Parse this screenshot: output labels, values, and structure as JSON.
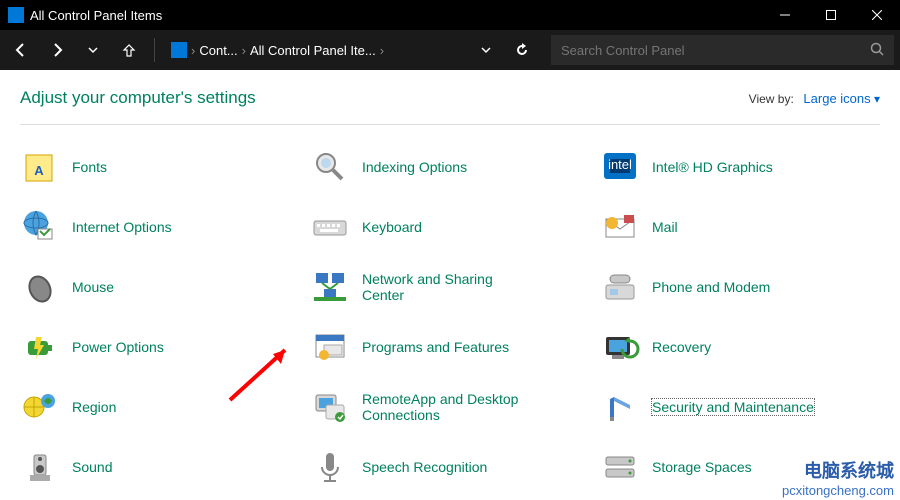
{
  "title": "All Control Panel Items",
  "breadcrumb": {
    "crumb1": "Cont...",
    "crumb2": "All Control Panel Ite..."
  },
  "search": {
    "placeholder": "Search Control Panel"
  },
  "header": {
    "heading": "Adjust your computer's settings",
    "viewby": "View by:",
    "viewby_value": "Large icons"
  },
  "items": {
    "fonts": "Fonts",
    "indexing": "Indexing Options",
    "intel": "Intel® HD Graphics",
    "internet": "Internet Options",
    "keyboard": "Keyboard",
    "mail": "Mail",
    "mouse": "Mouse",
    "network": "Network and Sharing Center",
    "phone": "Phone and Modem",
    "power": "Power Options",
    "programs": "Programs and Features",
    "recovery": "Recovery",
    "region": "Region",
    "remoteapp": "RemoteApp and Desktop Connections",
    "security": "Security and Maintenance",
    "sound": "Sound",
    "speech": "Speech Recognition",
    "storage": "Storage Spaces"
  },
  "watermark": {
    "cn": "电脑系统城",
    "url": "pcxitongcheng.com"
  }
}
